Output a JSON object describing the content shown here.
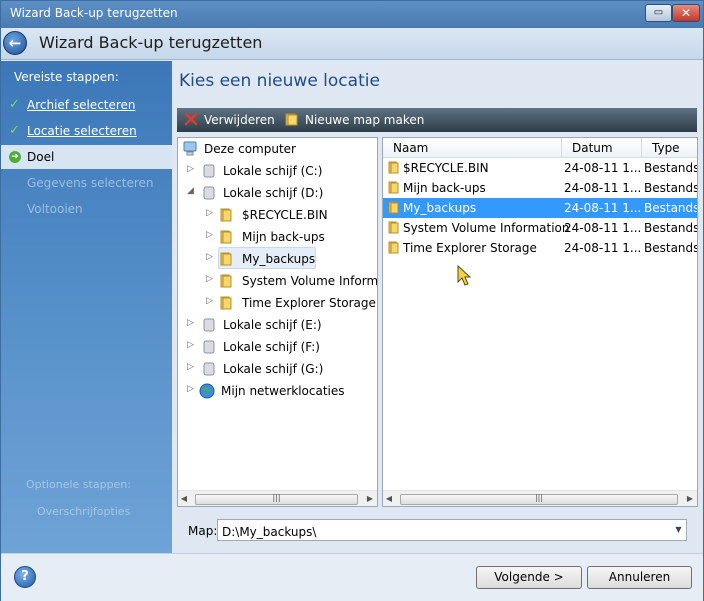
{
  "window": {
    "title": "Wizard Back-up terugzetten",
    "header_title": "Wizard Back-up terugzetten"
  },
  "sidebar": {
    "required_heading": "Vereiste stappen:",
    "steps": [
      {
        "label": "Archief selecteren",
        "state": "done"
      },
      {
        "label": "Locatie selecteren",
        "state": "done"
      },
      {
        "label": "Doel",
        "state": "current"
      },
      {
        "label": "Gegevens selecteren",
        "state": "pending"
      },
      {
        "label": "Voltooien",
        "state": "pending"
      }
    ],
    "optional_heading": "Optionele stappen:",
    "optional_item": "Overschrijfopties"
  },
  "main": {
    "title": "Kies een nieuwe locatie",
    "toolbar": {
      "delete_label": "Verwijderen",
      "newfolder_label": "Nieuwe map maken"
    },
    "tree": {
      "root": "Deze computer",
      "nodes": [
        "Lokale schijf (C:)",
        "Lokale schijf (D:)",
        "$RECYCLE.BIN",
        "Mijn back-ups",
        "My_backups",
        "System Volume Informat",
        "Time Explorer Storage",
        "Lokale schijf (E:)",
        "Lokale schijf (F:)",
        "Lokale schijf (G:)",
        "Mijn netwerklocaties"
      ]
    },
    "list": {
      "columns": [
        "Naam",
        "Datum",
        "Type"
      ],
      "rows": [
        {
          "name": "$RECYCLE.BIN",
          "date": "24-08-11 1...",
          "type": "Bestandsm"
        },
        {
          "name": "Mijn back-ups",
          "date": "24-08-11 1...",
          "type": "Bestandsm"
        },
        {
          "name": "My_backups",
          "date": "24-08-11 1...",
          "type": "Bestandsm"
        },
        {
          "name": "System Volume Information",
          "date": "24-08-11 1...",
          "type": "Bestandsm"
        },
        {
          "name": "Time Explorer Storage",
          "date": "24-08-11 1...",
          "type": "Bestandsm"
        }
      ]
    },
    "map_label": "Map:",
    "map_value": "D:\\My_backups\\"
  },
  "footer": {
    "next_label": "Volgende >",
    "cancel_label": "Annuleren"
  },
  "colors": {
    "sidebar_blue": "#4a85c2",
    "selection_blue": "#3399ff",
    "title_blue": "#1e4d86"
  }
}
